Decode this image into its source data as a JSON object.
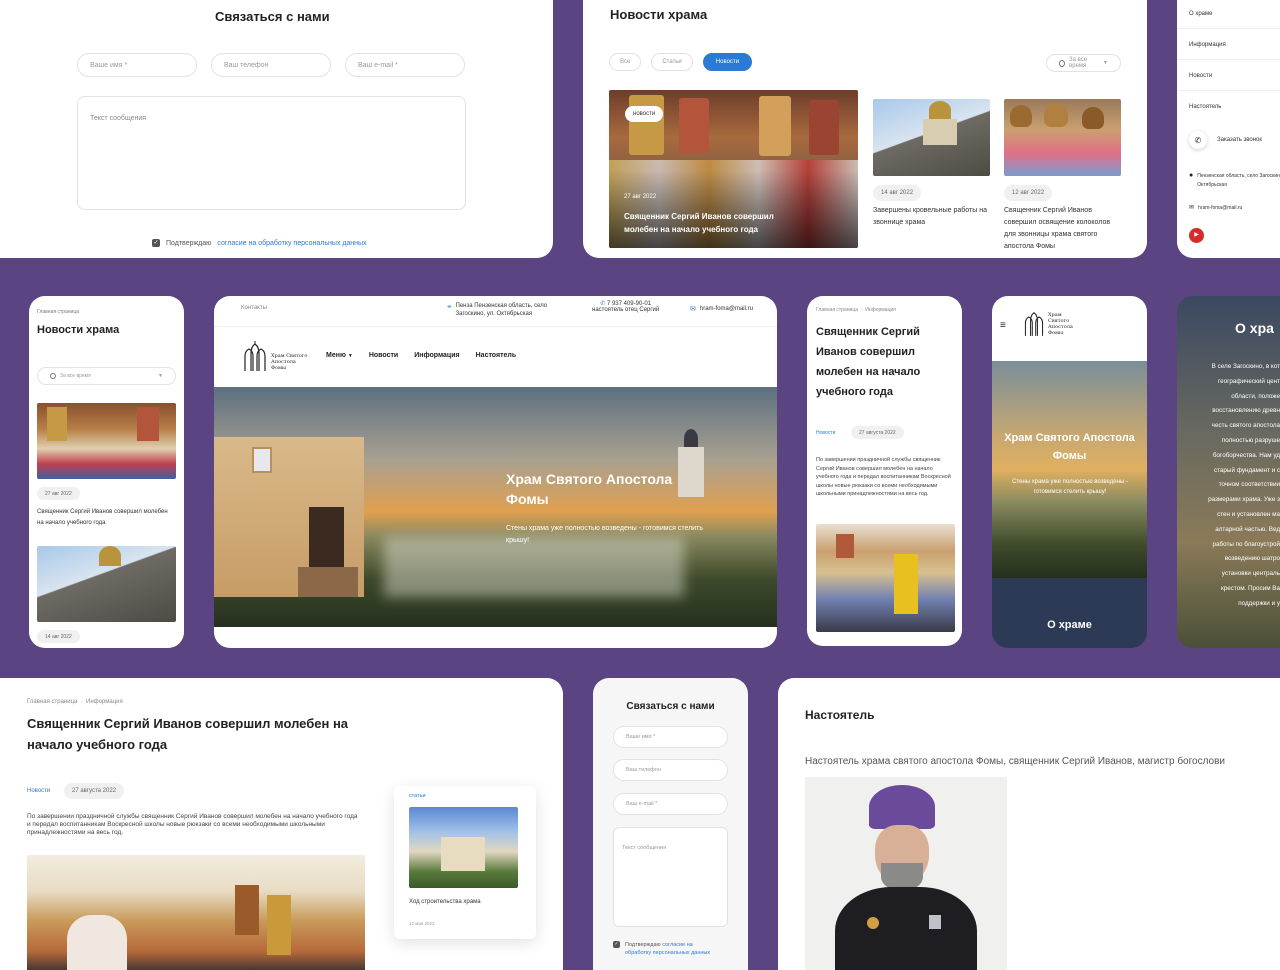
{
  "contact_top": {
    "title": "Связаться с нами",
    "name_placeholder": "Ваше имя *",
    "phone_placeholder": "Ваш телефон",
    "email_placeholder": "Ваш e-mail *",
    "message_placeholder": "Текст сообщения",
    "consent_prefix": "Подтверждаю",
    "consent_link": "согласие на обработку персональных данных"
  },
  "news_top": {
    "title": "Новости храма",
    "filters": [
      "Все",
      "Статьи",
      "Новости"
    ],
    "period": "За все время",
    "main_tag": "новости",
    "main_date": "27 авг 2022",
    "main_caption": "Священник Сергий Иванов совершил молебен на начало учебного года",
    "item1_date": "14 авг 2022",
    "item1_text": "Завершены кровельные работы на звоннице храма",
    "item2_date": "12 авг 2022",
    "item2_text": "Священник Сергий Иванов совершил освящение колоколов для звонницы храма святого апостола Фомы"
  },
  "side_menu": {
    "items": [
      "О храме",
      "Информация",
      "Новости",
      "Настоятель"
    ],
    "call": "Заказать звонок",
    "address": "Пензенская область, село Загоскино, ул. Октябрьская",
    "email": "hram-foma@mail.ru"
  },
  "mobile_news": {
    "breadcrumb": "Главная страница",
    "title": "Новости храма",
    "period": "За все время",
    "item1_date": "27 авг 2022",
    "item1_text": "Священник Сергий Иванов совершил молебен на начало учебного года",
    "item2_date": "14 авг 2022"
  },
  "desktop": {
    "contacts_link": "Контакты",
    "address": "Пенза Пензенская область, село Загоскино, ул. Октябрьская",
    "phone": "7 937 409-90-01",
    "phone_sub": "настоятель отец Сергий",
    "email": "hram-foma@mail.ru",
    "logo": "Храм Святого Апостола Фомы",
    "nav": [
      "Меню",
      "Новости",
      "Информация",
      "Настоятель"
    ],
    "hero_title": "Храм Святого Апостола Фомы",
    "hero_sub": "Стены храма уже полностью возведены - готовимся стелить крышу!"
  },
  "article_mobile": {
    "breadcrumb1": "Главная страница",
    "breadcrumb2": "Информация",
    "title": "Священник Сергий Иванов совершил молебен на начало учебного года",
    "tag": "Новости",
    "date": "27 августа 2022",
    "body": "По завершении праздничной службы священник Сергий Иванов совершил молебен на начало учебного года и передал воспитанникам Воскресной школы новые рюкзаки со всеми необходимыми школьными принадлежностями на весь год."
  },
  "mobile_hero": {
    "logo": "Храм Святого Апостола Фомы",
    "title": "Храм Святого Апостола Фомы",
    "sub": "Стены храма уже полностью возведены - готовимся стелить крышу!",
    "about": "О храме"
  },
  "about_partial": {
    "title": "О хра",
    "lines": [
      "В селе Загоскино, в кот",
      "географический цент",
      "области, положе",
      "восстановлению древн",
      "честь святого апостола",
      "полностью разруше",
      "богоборчества. Нам уд",
      "старый фундамент и с",
      "точном соответствии",
      "размерами храма. Уже з",
      "стен и установлен ма",
      "алтарной частью. Вед",
      "работы по благоустрой",
      "возведению шатро",
      "установки централь",
      "крестом. Просим Ва",
      "поддержки и у"
    ]
  },
  "article_desktop": {
    "breadcrumb1": "Главная страница",
    "breadcrumb2": "Информация",
    "title": "Священник Сергий Иванов совершил молебен на начало учебного года",
    "tag": "Новости",
    "date": "27 августа 2022",
    "body": "По завершении праздничной службы священник Сергий Иванов совершил молебен на начало учебного года и передал воспитанникам Воскресной школы новые рюкзаки со всеми необходимыми школьными принадлежностями на весь год.",
    "side_tag": "статьи",
    "side_title": "Ход строительства храма",
    "side_date": "12 мая 2022"
  },
  "contact_mobile": {
    "title": "Связаться с нами",
    "name_placeholder": "Ваше имя *",
    "phone_placeholder": "Ваш телефон",
    "email_placeholder": "Ваш e-mail *",
    "message_placeholder": "Текст сообщения",
    "consent_prefix": "Подтверждаю",
    "consent_link": "согласие на обработку персональных данных"
  },
  "rector": {
    "title": "Настоятель",
    "text": "Настоятель храма святого апостола Фомы, священник Сергий Иванов, магистр богослови"
  },
  "colors": {
    "purple_bg": "#5b4482",
    "accent_blue": "#2a7ad6",
    "dark_card": "#2c3a55"
  }
}
